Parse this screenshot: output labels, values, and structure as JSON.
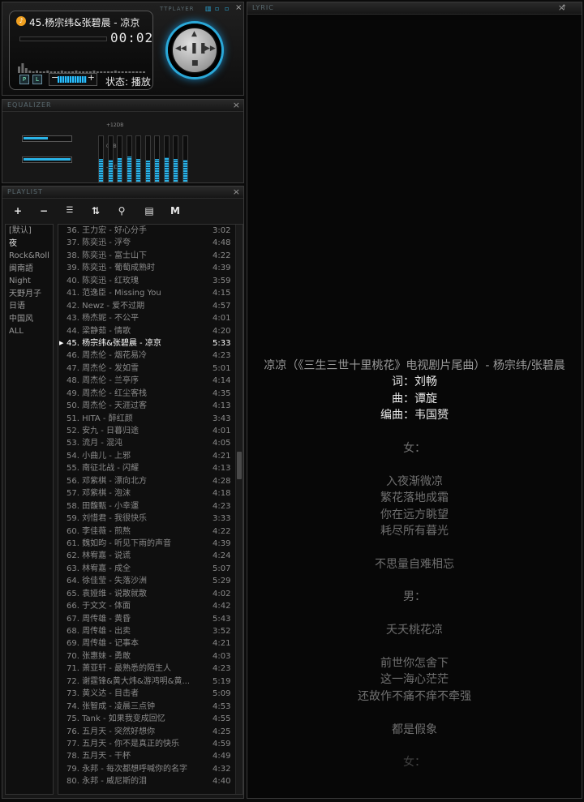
{
  "player": {
    "window_title": "TTPLAYER",
    "song_title": "45.杨宗纬&张碧晨 - 凉京",
    "elapsed": "00:02",
    "status": "状态: 播放",
    "volume_percent": 75,
    "btn_p": "P",
    "btn_l": "L"
  },
  "equalizer": {
    "window_title": "EQUALIZER",
    "top_label": "+12DB",
    "mid_label": "0DB",
    "bottom_label": "-12DB",
    "preamp_levels": [
      0.55,
      0.5
    ],
    "band_levels": [
      0.5,
      0.48,
      0.52,
      0.55,
      0.5,
      0.47,
      0.5,
      0.53,
      0.5,
      0.48
    ]
  },
  "playlist": {
    "window_title": "PLAYLIST",
    "toolbar": [
      "+",
      "−",
      "☰",
      "⇅",
      "⚲",
      "▤",
      "M"
    ],
    "categories": [
      "[默认]",
      "夜",
      "Rock&Roll",
      "闽南語",
      "Night",
      "天野月子",
      "日语",
      "中国风",
      "ALL"
    ],
    "selected_category": 1,
    "tracks": [
      {
        "name": "36. 王力宏 - 好心分手",
        "time": "3:02"
      },
      {
        "name": "37. 陈奕迅 - 浮夸",
        "time": "4:48"
      },
      {
        "name": "38. 陈奕迅 - 富士山下",
        "time": "4:22"
      },
      {
        "name": "39. 陈奕迅 - 葡萄成熟时",
        "time": "4:39"
      },
      {
        "name": "40. 陈奕迅 - 红玫瑰",
        "time": "3:59"
      },
      {
        "name": "41. 范逸臣 - Missing You",
        "time": "4:15"
      },
      {
        "name": "42. Newz - 爱不过期",
        "time": "4:57"
      },
      {
        "name": "43. 杨杰妮 - 不公平",
        "time": "4:01"
      },
      {
        "name": "44. 梁静茹 - 情歌",
        "time": "4:20"
      },
      {
        "name": "45. 杨宗纬&张碧晨 - 凉京",
        "time": "5:33"
      },
      {
        "name": "46. 周杰伦 - 烟花易冷",
        "time": "4:23"
      },
      {
        "name": "47. 周杰伦 - 发如雪",
        "time": "5:01"
      },
      {
        "name": "48. 周杰伦 - 兰亭序",
        "time": "4:14"
      },
      {
        "name": "49. 周杰伦 - 红尘客栈",
        "time": "4:35"
      },
      {
        "name": "50. 周杰伦 - 天涯过客",
        "time": "4:13"
      },
      {
        "name": "51. HITA - 醉红颜",
        "time": "3:43"
      },
      {
        "name": "52. 安九 - 日暮归途",
        "time": "4:01"
      },
      {
        "name": "53. 流月 - 混沌",
        "time": "4:05"
      },
      {
        "name": "54. 小曲儿 - 上邪",
        "time": "4:21"
      },
      {
        "name": "55. 南征北战 - 闪耀",
        "time": "4:13"
      },
      {
        "name": "56. 邓紫棋 - 漂向北方",
        "time": "4:28"
      },
      {
        "name": "57. 邓紫棋 - 泡沫",
        "time": "4:18"
      },
      {
        "name": "58. 田馥甄 - 小幸運",
        "time": "4:23"
      },
      {
        "name": "59. 刘惜君 - 我很快乐",
        "time": "3:33"
      },
      {
        "name": "60. 李佳薇 - 煎熬",
        "time": "4:22"
      },
      {
        "name": "61. 魏如昀 - 听见下雨的声音",
        "time": "4:39"
      },
      {
        "name": "62. 林宥嘉 - 说谎",
        "time": "4:24"
      },
      {
        "name": "63. 林宥嘉 - 成全",
        "time": "5:07"
      },
      {
        "name": "64. 徐佳莹 - 失落沙洲",
        "time": "5:29"
      },
      {
        "name": "65. 袁娅维 - 说散就散",
        "time": "4:02"
      },
      {
        "name": "66. 于文文 - 体面",
        "time": "4:42"
      },
      {
        "name": "67. 周传雄 - 黄昏",
        "time": "5:43"
      },
      {
        "name": "68. 周传雄 - 出卖",
        "time": "3:52"
      },
      {
        "name": "69. 周传雄 - 记事本",
        "time": "4:21"
      },
      {
        "name": "70. 张惠妹 - 勇敢",
        "time": "4:03"
      },
      {
        "name": "71. 萧亚轩 - 最熟悉的陌生人",
        "time": "4:23"
      },
      {
        "name": "72. 谢霆锋&黄大炜&游鸿明&黄...",
        "time": "5:19"
      },
      {
        "name": "73. 黄义达 - 目击者",
        "time": "5:09"
      },
      {
        "name": "74. 张智成 - 凌晨三点钟",
        "time": "4:53"
      },
      {
        "name": "75. Tank - 如果我变成回忆",
        "time": "4:55"
      },
      {
        "name": "76. 五月天 - 突然好想你",
        "time": "4:25"
      },
      {
        "name": "77. 五月天 - 你不是真正的快乐",
        "time": "4:59"
      },
      {
        "name": "78. 五月天 - 干杯",
        "time": "4:49"
      },
      {
        "name": "79. 永邦 - 每次都想呼喊你的名字",
        "time": "4:32"
      },
      {
        "name": "80. 永邦 - 威尼斯的泪",
        "time": "4:40"
      }
    ],
    "active_index": 9
  },
  "lyric": {
    "window_title": "LYRIC",
    "lines": [
      {
        "text": "凉凉（《三生三世十里桃花》电视剧片尾曲）- 杨宗纬/张碧晨",
        "style": "mid"
      },
      {
        "text": "词：刘畅",
        "style": "hi"
      },
      {
        "text": "曲：谭旋",
        "style": "hi"
      },
      {
        "text": "编曲：韦国赟",
        "style": "hi"
      },
      {
        "text": "",
        "style": ""
      },
      {
        "text": "女：",
        "style": ""
      },
      {
        "text": "",
        "style": ""
      },
      {
        "text": "入夜渐微凉",
        "style": ""
      },
      {
        "text": "繁花落地成霜",
        "style": ""
      },
      {
        "text": "你在远方眺望",
        "style": ""
      },
      {
        "text": "耗尽所有暮光",
        "style": ""
      },
      {
        "text": "",
        "style": ""
      },
      {
        "text": "不思量自难相忘",
        "style": ""
      },
      {
        "text": "",
        "style": ""
      },
      {
        "text": "男：",
        "style": ""
      },
      {
        "text": "",
        "style": ""
      },
      {
        "text": "夭夭桃花凉",
        "style": ""
      },
      {
        "text": "",
        "style": ""
      },
      {
        "text": "前世你怎舍下",
        "style": ""
      },
      {
        "text": "这一海心茫茫",
        "style": ""
      },
      {
        "text": "还故作不痛不痒不牵强",
        "style": ""
      },
      {
        "text": "",
        "style": ""
      },
      {
        "text": "都是假象",
        "style": ""
      },
      {
        "text": "",
        "style": ""
      },
      {
        "text": "女：",
        "style": "dim"
      }
    ]
  },
  "colors": {
    "accent": "#2ab4e8",
    "text_bright": "#e8e8e8",
    "text_dim": "#8a8a8a"
  }
}
